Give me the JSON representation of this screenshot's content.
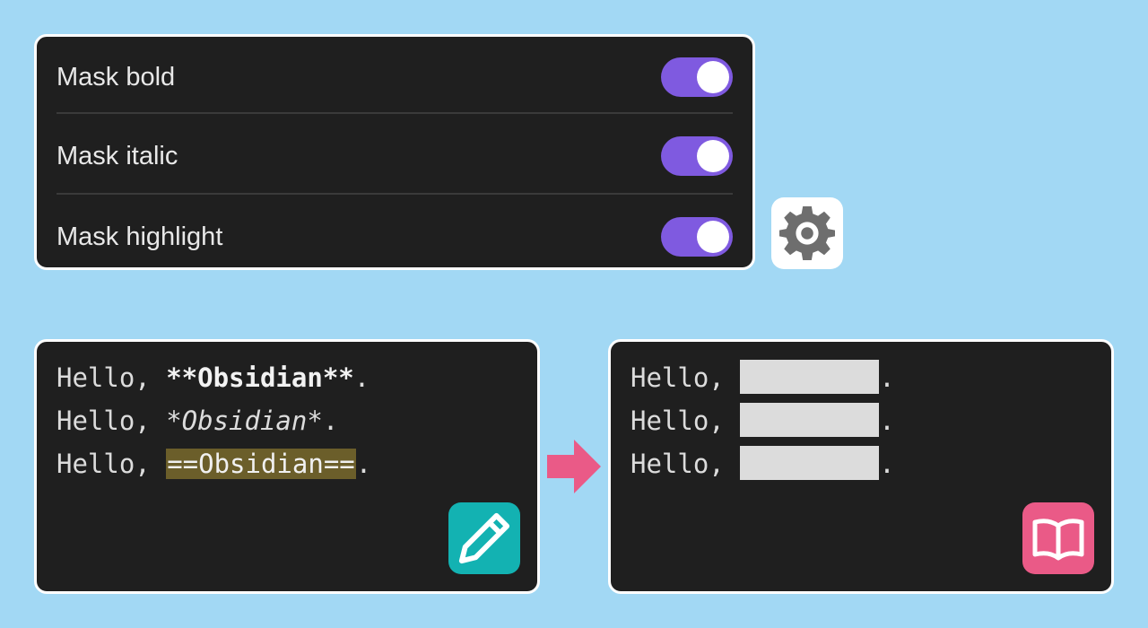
{
  "settings": {
    "items": [
      {
        "label": "Mask bold",
        "enabled": true
      },
      {
        "label": "Mask italic",
        "enabled": true
      },
      {
        "label": "Mask highlight",
        "enabled": true
      }
    ]
  },
  "editor": {
    "lines": [
      {
        "prefix": "Hello, ",
        "content": "**Obsidian**",
        "suffix": "."
      },
      {
        "prefix": "Hello, ",
        "content": "*Obsidian*",
        "suffix": "."
      },
      {
        "prefix": "Hello, ",
        "content": "==Obsidian==",
        "suffix": "."
      }
    ]
  },
  "preview": {
    "lines": [
      {
        "prefix": "Hello, ",
        "suffix": "."
      },
      {
        "prefix": "Hello, ",
        "suffix": "."
      },
      {
        "prefix": "Hello, ",
        "suffix": "."
      }
    ]
  },
  "icons": {
    "settings": "gear-icon",
    "edit": "pencil-icon",
    "read": "book-open-icon",
    "arrow": "arrow-right-icon"
  },
  "colors": {
    "background": "#a2d8f4",
    "panel": "#1f1f1f",
    "toggle_on": "#7f5ae0",
    "highlight": "#6b5e2a",
    "mask": "#dcdcdc",
    "edit_badge": "#13b2b2",
    "read_badge": "#ea5a87",
    "arrow": "#ea5a87"
  }
}
